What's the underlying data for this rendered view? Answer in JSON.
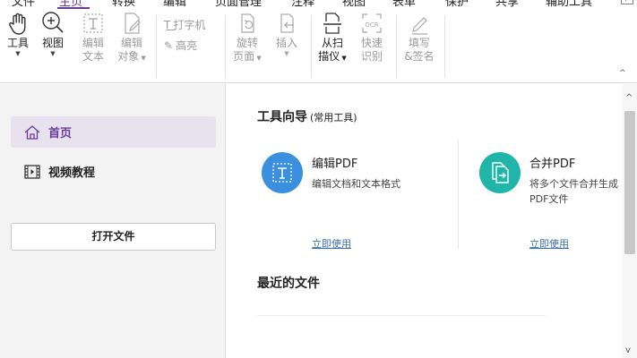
{
  "menu": {
    "items": [
      "文件",
      "主页",
      "转换",
      "编辑",
      "页面管理",
      "注释",
      "视图",
      "表单",
      "保护",
      "共享",
      "辅助工具"
    ],
    "active": "主页"
  },
  "ribbon": {
    "tool": "工具",
    "view": "视图",
    "edit_text_1": "编辑",
    "edit_text_2": "文本",
    "edit_obj_1": "编辑",
    "edit_obj_2": "对象",
    "typewriter": "打字机",
    "highlight": "高亮",
    "rotate_1": "旋转",
    "rotate_2": "页面",
    "insert": "插入",
    "scan_1": "从扫",
    "scan_2": "描仪",
    "ocr_1": "快速",
    "ocr_2": "识别",
    "sign_1": "填写",
    "sign_2": "&签名"
  },
  "sidebar": {
    "home": "首页",
    "video": "视频教程",
    "open_file": "打开文件"
  },
  "main": {
    "title": "工具向导",
    "subtitle": "(常用工具)",
    "cards": [
      {
        "title": "编辑PDF",
        "desc": "编辑文档和文本格式",
        "link": "立即使用",
        "color": "#3a8fde"
      },
      {
        "title": "合并PDF",
        "desc": "将多个文件合并生成PDF文件",
        "link": "立即使用",
        "color": "#1fb5a8"
      }
    ],
    "recent_title": "最近的文件"
  },
  "colors": {
    "accent": "#6a3a9a",
    "link": "#3d6fb5"
  }
}
